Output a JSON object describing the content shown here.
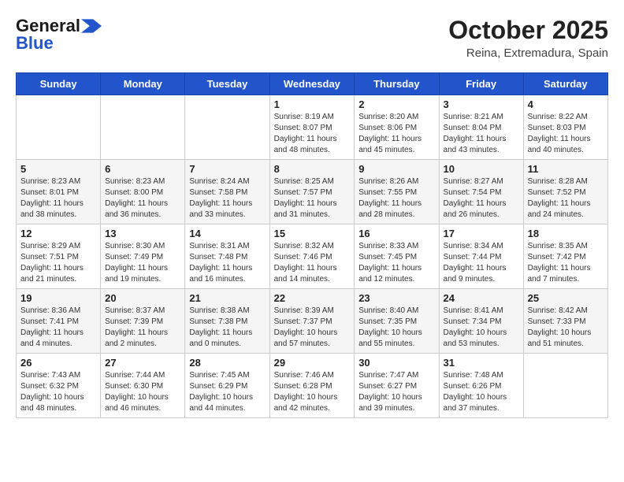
{
  "logo": {
    "line1": "General",
    "line2": "Blue"
  },
  "title": "October 2025",
  "location": "Reina, Extremadura, Spain",
  "days_of_week": [
    "Sunday",
    "Monday",
    "Tuesday",
    "Wednesday",
    "Thursday",
    "Friday",
    "Saturday"
  ],
  "weeks": [
    [
      {
        "day": "",
        "info": ""
      },
      {
        "day": "",
        "info": ""
      },
      {
        "day": "",
        "info": ""
      },
      {
        "day": "1",
        "info": "Sunrise: 8:19 AM\nSunset: 8:07 PM\nDaylight: 11 hours and 48 minutes."
      },
      {
        "day": "2",
        "info": "Sunrise: 8:20 AM\nSunset: 8:06 PM\nDaylight: 11 hours and 45 minutes."
      },
      {
        "day": "3",
        "info": "Sunrise: 8:21 AM\nSunset: 8:04 PM\nDaylight: 11 hours and 43 minutes."
      },
      {
        "day": "4",
        "info": "Sunrise: 8:22 AM\nSunset: 8:03 PM\nDaylight: 11 hours and 40 minutes."
      }
    ],
    [
      {
        "day": "5",
        "info": "Sunrise: 8:23 AM\nSunset: 8:01 PM\nDaylight: 11 hours and 38 minutes."
      },
      {
        "day": "6",
        "info": "Sunrise: 8:23 AM\nSunset: 8:00 PM\nDaylight: 11 hours and 36 minutes."
      },
      {
        "day": "7",
        "info": "Sunrise: 8:24 AM\nSunset: 7:58 PM\nDaylight: 11 hours and 33 minutes."
      },
      {
        "day": "8",
        "info": "Sunrise: 8:25 AM\nSunset: 7:57 PM\nDaylight: 11 hours and 31 minutes."
      },
      {
        "day": "9",
        "info": "Sunrise: 8:26 AM\nSunset: 7:55 PM\nDaylight: 11 hours and 28 minutes."
      },
      {
        "day": "10",
        "info": "Sunrise: 8:27 AM\nSunset: 7:54 PM\nDaylight: 11 hours and 26 minutes."
      },
      {
        "day": "11",
        "info": "Sunrise: 8:28 AM\nSunset: 7:52 PM\nDaylight: 11 hours and 24 minutes."
      }
    ],
    [
      {
        "day": "12",
        "info": "Sunrise: 8:29 AM\nSunset: 7:51 PM\nDaylight: 11 hours and 21 minutes."
      },
      {
        "day": "13",
        "info": "Sunrise: 8:30 AM\nSunset: 7:49 PM\nDaylight: 11 hours and 19 minutes."
      },
      {
        "day": "14",
        "info": "Sunrise: 8:31 AM\nSunset: 7:48 PM\nDaylight: 11 hours and 16 minutes."
      },
      {
        "day": "15",
        "info": "Sunrise: 8:32 AM\nSunset: 7:46 PM\nDaylight: 11 hours and 14 minutes."
      },
      {
        "day": "16",
        "info": "Sunrise: 8:33 AM\nSunset: 7:45 PM\nDaylight: 11 hours and 12 minutes."
      },
      {
        "day": "17",
        "info": "Sunrise: 8:34 AM\nSunset: 7:44 PM\nDaylight: 11 hours and 9 minutes."
      },
      {
        "day": "18",
        "info": "Sunrise: 8:35 AM\nSunset: 7:42 PM\nDaylight: 11 hours and 7 minutes."
      }
    ],
    [
      {
        "day": "19",
        "info": "Sunrise: 8:36 AM\nSunset: 7:41 PM\nDaylight: 11 hours and 4 minutes."
      },
      {
        "day": "20",
        "info": "Sunrise: 8:37 AM\nSunset: 7:39 PM\nDaylight: 11 hours and 2 minutes."
      },
      {
        "day": "21",
        "info": "Sunrise: 8:38 AM\nSunset: 7:38 PM\nDaylight: 11 hours and 0 minutes."
      },
      {
        "day": "22",
        "info": "Sunrise: 8:39 AM\nSunset: 7:37 PM\nDaylight: 10 hours and 57 minutes."
      },
      {
        "day": "23",
        "info": "Sunrise: 8:40 AM\nSunset: 7:35 PM\nDaylight: 10 hours and 55 minutes."
      },
      {
        "day": "24",
        "info": "Sunrise: 8:41 AM\nSunset: 7:34 PM\nDaylight: 10 hours and 53 minutes."
      },
      {
        "day": "25",
        "info": "Sunrise: 8:42 AM\nSunset: 7:33 PM\nDaylight: 10 hours and 51 minutes."
      }
    ],
    [
      {
        "day": "26",
        "info": "Sunrise: 7:43 AM\nSunset: 6:32 PM\nDaylight: 10 hours and 48 minutes."
      },
      {
        "day": "27",
        "info": "Sunrise: 7:44 AM\nSunset: 6:30 PM\nDaylight: 10 hours and 46 minutes."
      },
      {
        "day": "28",
        "info": "Sunrise: 7:45 AM\nSunset: 6:29 PM\nDaylight: 10 hours and 44 minutes."
      },
      {
        "day": "29",
        "info": "Sunrise: 7:46 AM\nSunset: 6:28 PM\nDaylight: 10 hours and 42 minutes."
      },
      {
        "day": "30",
        "info": "Sunrise: 7:47 AM\nSunset: 6:27 PM\nDaylight: 10 hours and 39 minutes."
      },
      {
        "day": "31",
        "info": "Sunrise: 7:48 AM\nSunset: 6:26 PM\nDaylight: 10 hours and 37 minutes."
      },
      {
        "day": "",
        "info": ""
      }
    ]
  ]
}
